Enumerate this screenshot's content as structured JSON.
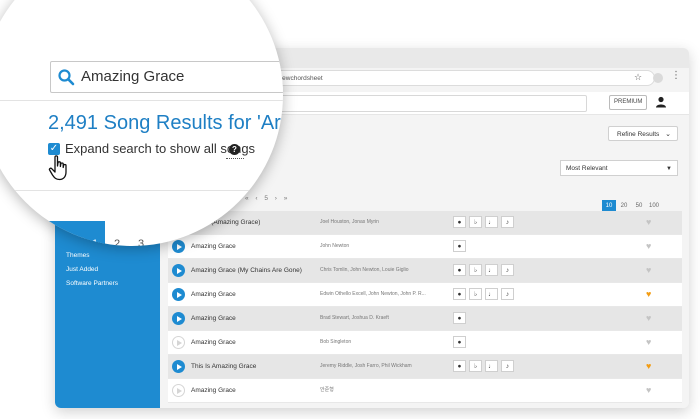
{
  "browser": {
    "url": "345/build-my-life/viewchordsheet"
  },
  "header": {
    "premium_label": "PREMIUM"
  },
  "magnifier": {
    "search_value": "Amazing Grace",
    "results_heading": "2,491 Song Results for 'Ar",
    "expand_label": "Expand search to show all songs",
    "help_glyph": "?",
    "pages": [
      "1",
      "2",
      "3"
    ]
  },
  "sidebar": {
    "items": [
      "Themes",
      "Just Added",
      "Software Partners"
    ]
  },
  "main": {
    "refine_label": "Refine Results",
    "sort_value": "Most Relevant",
    "pager_small": "« ‹ 5 › »",
    "per_page": [
      "10",
      "20",
      "50",
      "100"
    ],
    "per_page_active": "10"
  },
  "tool_glyphs": {
    "chat": "●",
    "flat": "♭",
    "note": "♩",
    "quarter": "♪"
  },
  "songs": [
    {
      "title": "essels (Amazing Grace)",
      "authors": "Joel Houston, Jonas Myrin",
      "playable": false,
      "tools": 4,
      "favorite": false
    },
    {
      "title": "Amazing Grace",
      "authors": "John Newton",
      "playable": true,
      "tools": 1,
      "favorite": false
    },
    {
      "title": "Amazing Grace (My Chains Are Gone)",
      "authors": "Chris Tomlin, John Newton, Louie Giglio",
      "playable": true,
      "tools": 4,
      "favorite": false
    },
    {
      "title": "Amazing Grace",
      "authors": "Edwin Othello Excell, John Newton, John P. R...",
      "playable": true,
      "tools": 4,
      "favorite": true
    },
    {
      "title": "Amazing Grace",
      "authors": "Brad Stewart, Joshua D. Kraeft",
      "playable": true,
      "tools": 1,
      "favorite": false
    },
    {
      "title": "Amazing Grace",
      "authors": "Bob Singleton",
      "playable": false,
      "tools": 1,
      "favorite": false
    },
    {
      "title": "This Is Amazing Grace",
      "authors": "Jeremy Riddle, Josh Farro, Phil Wickham",
      "playable": true,
      "tools": 4,
      "favorite": true
    },
    {
      "title": "Amazing Grace",
      "authors": "안준형",
      "playable": false,
      "tools": 0,
      "favorite": false
    }
  ],
  "colors": {
    "accent": "#1e8bd1",
    "heart_off": "#c4c4c4",
    "heart_on": "#f39c12"
  }
}
